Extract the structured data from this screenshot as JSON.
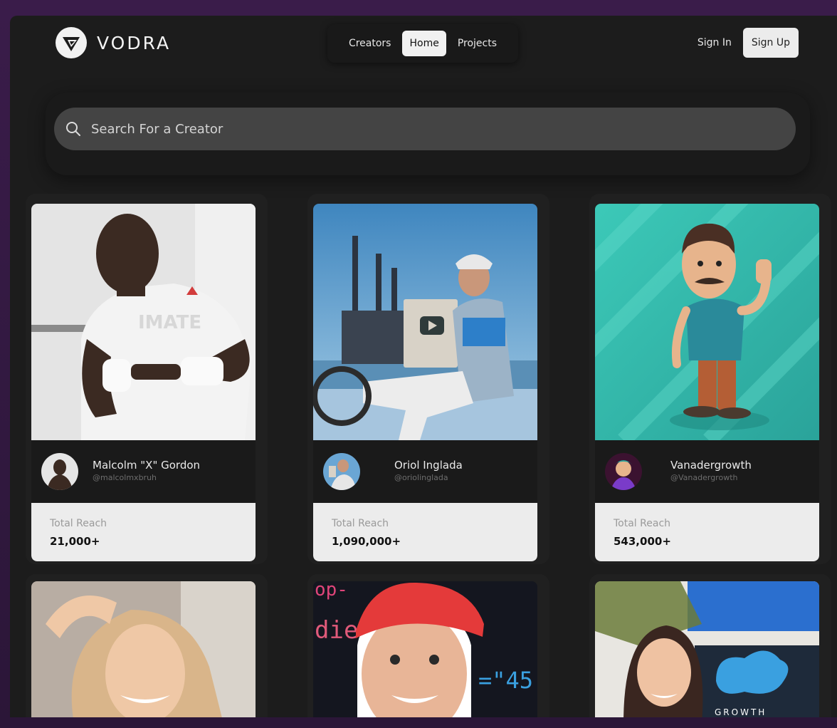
{
  "brand": {
    "name": "VODRA"
  },
  "nav": {
    "items": [
      {
        "label": "Creators"
      },
      {
        "label": "Home"
      },
      {
        "label": "Projects"
      }
    ],
    "active": "Home"
  },
  "auth": {
    "signin_label": "Sign In",
    "signup_label": "Sign Up"
  },
  "search": {
    "placeholder": "Search For a Creator"
  },
  "creators": [
    {
      "name": "Malcolm \"X\" Gordon",
      "handle": "@malcolmxbruh",
      "reach_label": "Total Reach",
      "reach": "21,000+"
    },
    {
      "name": "Oriol Inglada",
      "handle": "@oriolinglada",
      "reach_label": "Total Reach",
      "reach": "1,090,000+"
    },
    {
      "name": "Vanadergrowth",
      "handle": "@Vanadergrowth",
      "reach_label": "Total Reach",
      "reach": "543,000+"
    }
  ],
  "bottom_cards": {
    "card3_text": "GROWTH",
    "card2_code_1": "op-",
    "card2_code_2": "die",
    "card2_code_3": "=\"45"
  },
  "colors": {
    "frame": "#2b1638",
    "background": "#1c1c1c",
    "card_bottom": "#ececec",
    "search_bar": "#444444"
  }
}
